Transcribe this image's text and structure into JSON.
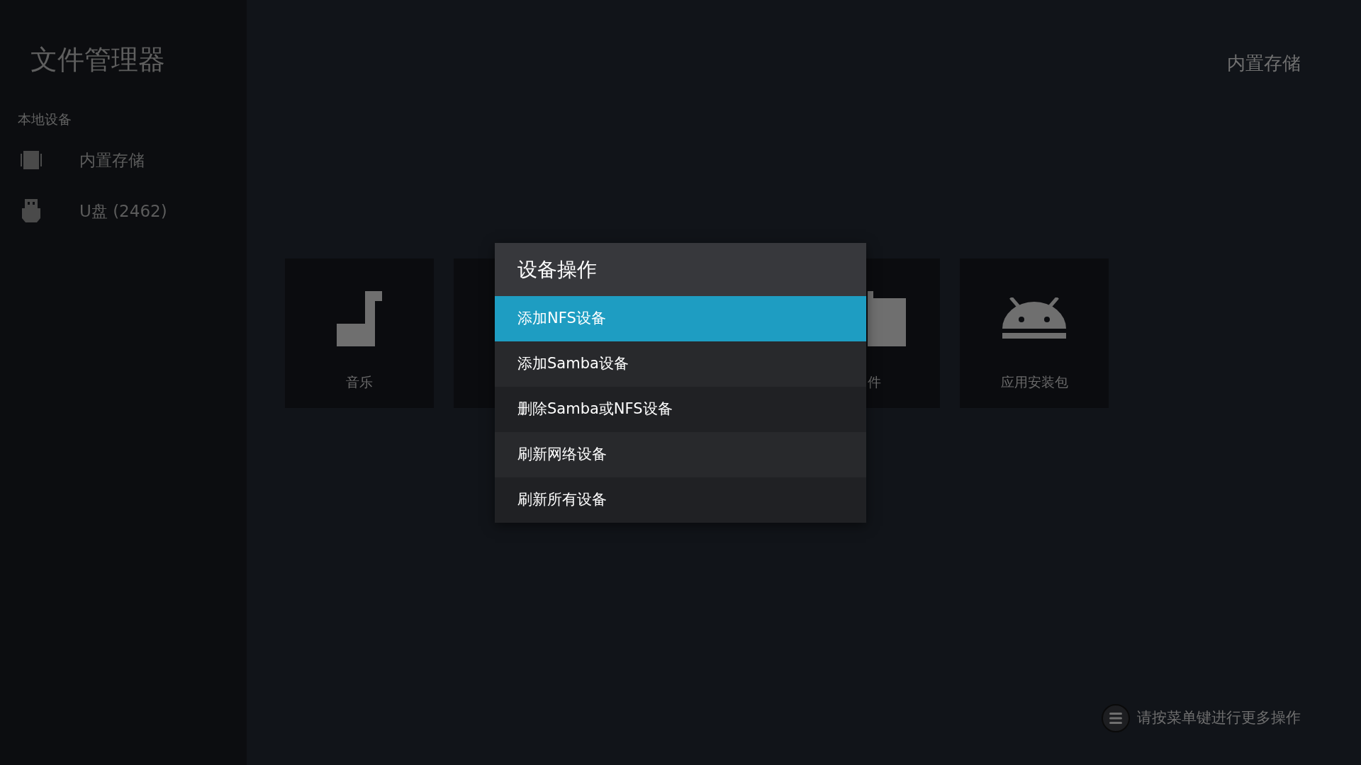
{
  "app_title": "文件管理器",
  "sidebar": {
    "section": "本地设备",
    "items": [
      {
        "kind": "storage",
        "label": "内置存储"
      },
      {
        "kind": "usb",
        "label": "U盘 (2462)"
      }
    ]
  },
  "header": {
    "location": "内置存储"
  },
  "tiles": [
    {
      "kind": "music",
      "label": "音乐"
    },
    {
      "kind": "blank"
    },
    {
      "kind": "folder",
      "label": "件"
    },
    {
      "kind": "android",
      "label": "应用安装包"
    }
  ],
  "dialog": {
    "title": "设备操作",
    "items": [
      {
        "label": "添加NFS设备",
        "selected": true
      },
      {
        "label": "添加Samba设备",
        "selected": false
      },
      {
        "label": "删除Samba或NFS设备",
        "selected": false
      },
      {
        "label": "刷新网络设备",
        "selected": false
      },
      {
        "label": "刷新所有设备",
        "selected": false
      }
    ]
  },
  "hint": "请按菜单键进行更多操作"
}
